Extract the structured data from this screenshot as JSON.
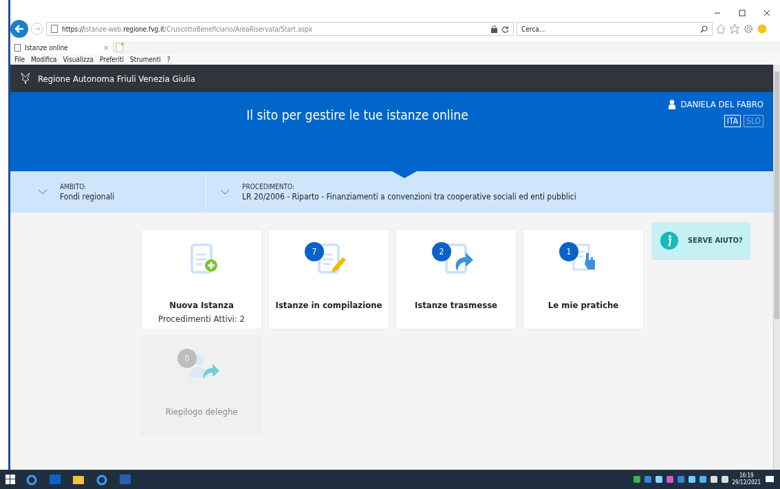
{
  "browser": {
    "url_prefix": "https://istanze-web.",
    "url_domain": "regione.fvg.it",
    "url_path": "/CruscottoBeneficiario/AreaRiservata/Start.aspx",
    "search_placeholder": "Cerca...",
    "tab_title": "Istanze online",
    "tab_close": "×",
    "menu": [
      "File",
      "Modifica",
      "Visualizza",
      "Preferiti",
      "Strumenti",
      "?"
    ]
  },
  "header": {
    "org": "Regione Autonoma Friuli Venezia Giulia"
  },
  "banner": {
    "title": "Il sito per gestire le tue istanze online",
    "user": "DANIELA DEL FABRO",
    "languages": [
      {
        "label": "ITA",
        "selected": true
      },
      {
        "label": "SLO",
        "selected": false
      }
    ]
  },
  "breadcrumb": [
    {
      "label": "AMBITO:",
      "value": "Fondi regionali"
    },
    {
      "label": "PROCEDIMENTO:",
      "value": "LR 20/2006 - Riparto - Finanziamenti a convenzioni tra cooperative sociali ed enti pubblici"
    }
  ],
  "tiles": [
    {
      "kind": "new",
      "title": "Nuova Istanza",
      "subtitle": "Procedimenti Attivi: 2",
      "disabled": false
    },
    {
      "kind": "draft",
      "badge": "7",
      "title": "Istanze in compilazione",
      "disabled": false
    },
    {
      "kind": "sent",
      "badge": "2",
      "title": "Istanze trasmesse",
      "disabled": false
    },
    {
      "kind": "practice",
      "badge": "1",
      "title": "Le mie pratiche",
      "disabled": false
    },
    {
      "kind": "delegate",
      "badge": "0",
      "title": "Riepilogo deleghe",
      "disabled": true
    }
  ],
  "help": {
    "label": "SERVE AIUTO?"
  },
  "taskbar": {
    "time": "16:19",
    "date": "29/12/2021"
  }
}
